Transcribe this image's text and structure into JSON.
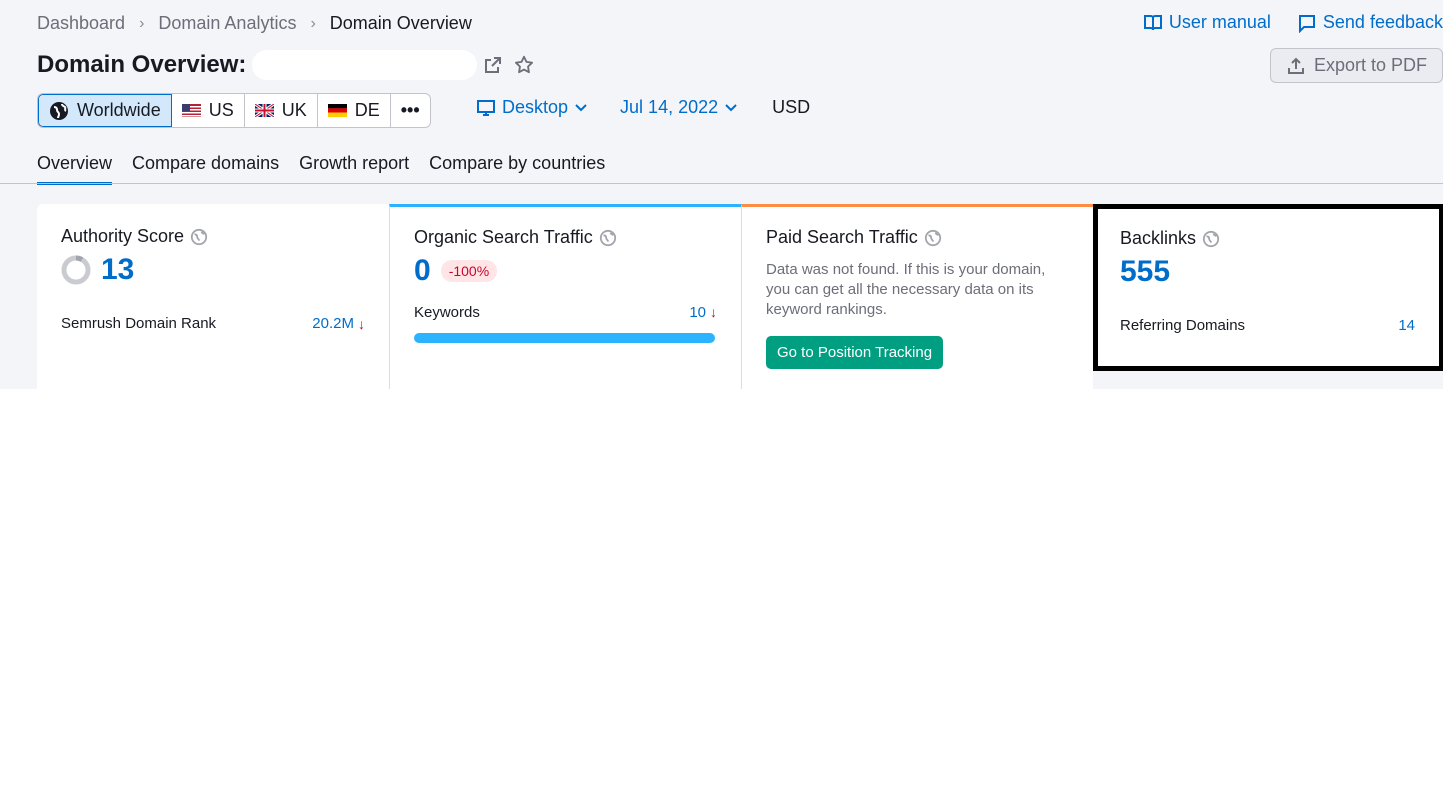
{
  "breadcrumb": {
    "items": [
      "Dashboard",
      "Domain Analytics",
      "Domain Overview"
    ]
  },
  "top_links": {
    "manual": "User manual",
    "feedback": "Send feedback"
  },
  "title": "Domain Overview:",
  "export_label": "Export to PDF",
  "databases": [
    {
      "label": "Worldwide",
      "icon": "globe-icon"
    },
    {
      "label": "US",
      "icon": "us-flag-icon"
    },
    {
      "label": "UK",
      "icon": "uk-flag-icon"
    },
    {
      "label": "DE",
      "icon": "de-flag-icon"
    }
  ],
  "more_label": "•••",
  "device": "Desktop",
  "date": "Jul 14, 2022",
  "currency": "USD",
  "tabs": [
    "Overview",
    "Compare domains",
    "Growth report",
    "Compare by countries"
  ],
  "cards": {
    "authority": {
      "title": "Authority Score",
      "value": "13",
      "row_label": "Semrush Domain Rank",
      "row_value": "20.2M"
    },
    "organic": {
      "title": "Organic Search Traffic",
      "value": "0",
      "change": "-100%",
      "row_label": "Keywords",
      "row_value": "10"
    },
    "paid": {
      "title": "Paid Search Traffic",
      "message": "Data was not found. If this is your domain, you can get all the necessary data on its keyword rankings.",
      "button": "Go to Position Tracking"
    },
    "backlinks": {
      "title": "Backlinks",
      "value": "555",
      "row_label": "Referring Domains",
      "row_value": "14"
    }
  },
  "colors": {
    "accent": "#006dca",
    "organic": "#2bb3ff",
    "paid": "#ff8c43",
    "button": "#009f81",
    "negative": "#d1002f"
  }
}
